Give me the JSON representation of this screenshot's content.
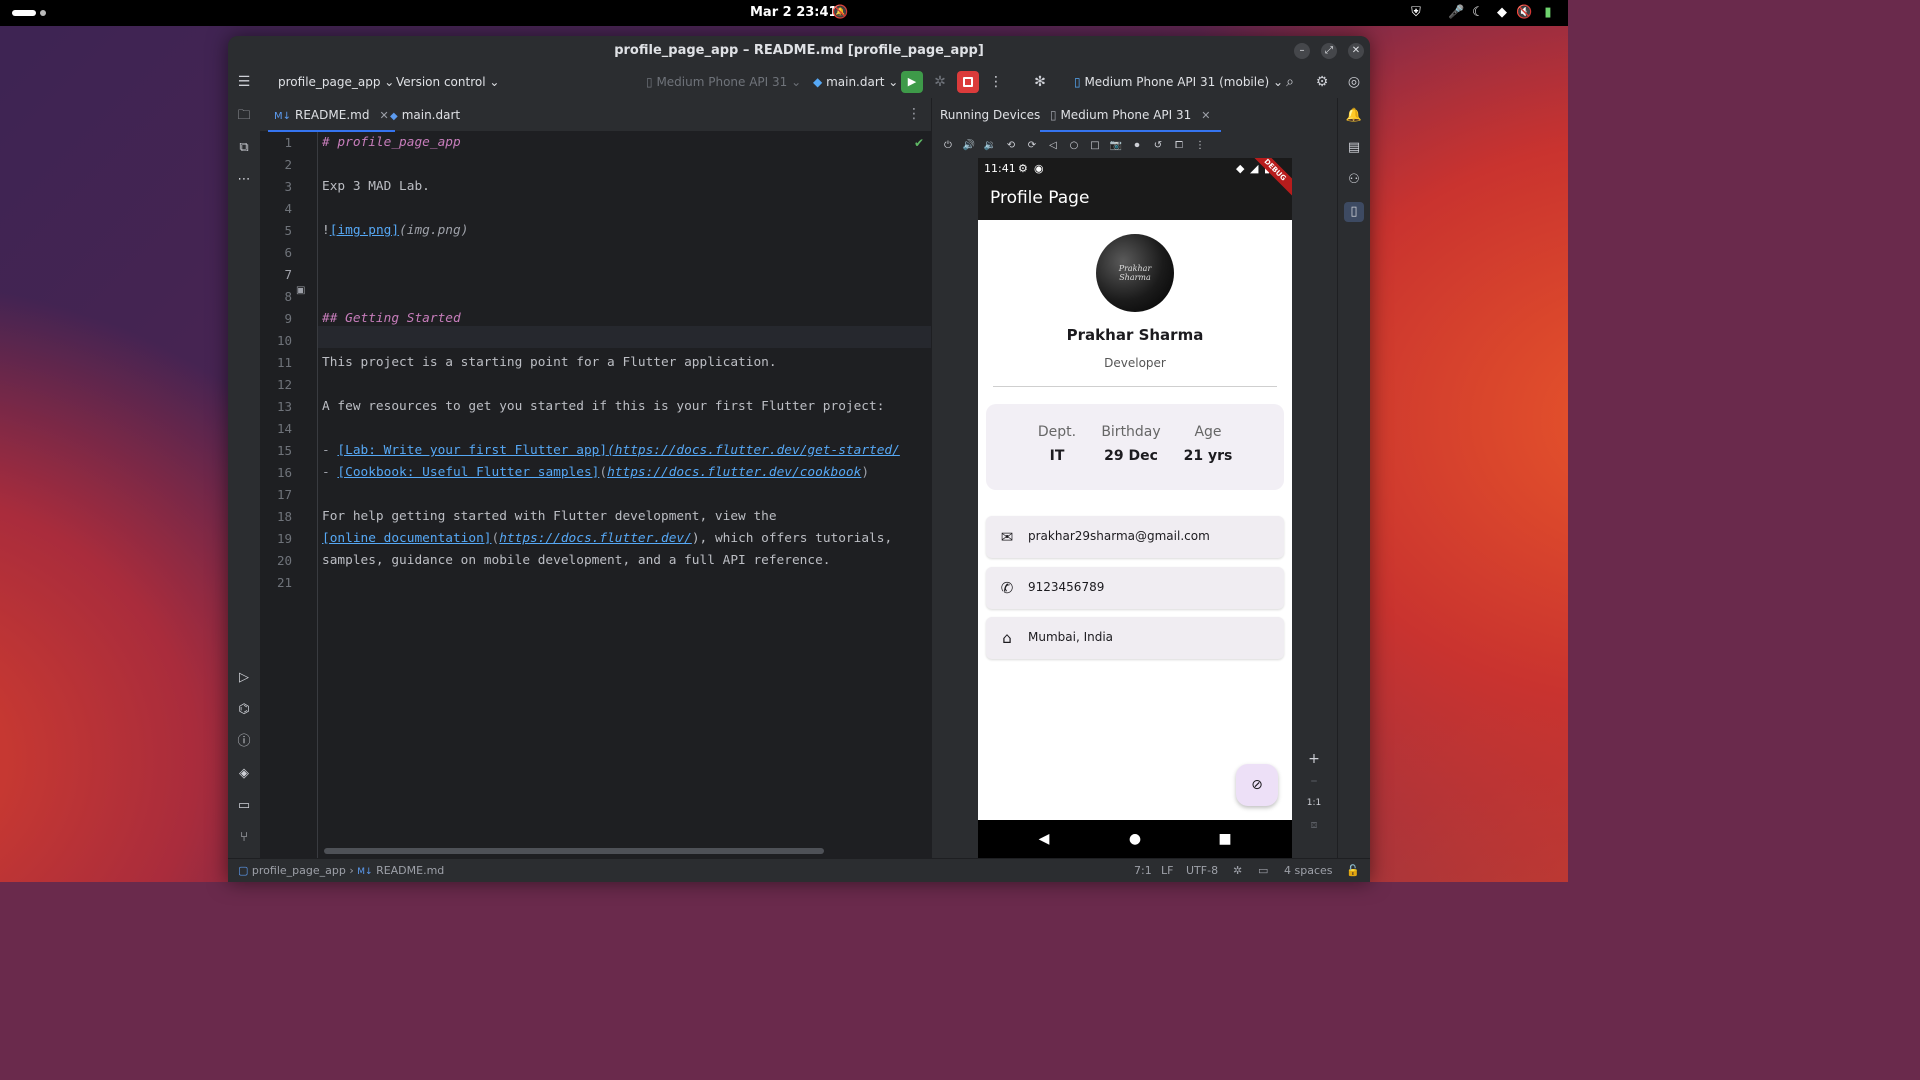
{
  "system": {
    "clock": "Mar 2  23:41"
  },
  "window": {
    "title": "profile_page_app – README.md [profile_page_app]"
  },
  "toolbar": {
    "project": "profile_page_app",
    "vcs": "Version control",
    "device_selector": "Medium Phone API 31",
    "run_config": "main.dart",
    "running_device": "Medium Phone API 31 (mobile)"
  },
  "editor": {
    "tabs": [
      {
        "label": "README.md",
        "icon": "M↓",
        "active": true
      },
      {
        "label": "main.dart",
        "icon": "dart-file-icon",
        "active": false
      }
    ],
    "current_line": 7,
    "lines": [
      {
        "n": "1",
        "text": "# profile_page_app"
      },
      {
        "n": "2",
        "text": ""
      },
      {
        "n": "3",
        "text": "Exp 3 MAD Lab."
      },
      {
        "n": "4",
        "text": ""
      },
      {
        "n": "5",
        "text": "![img.png](img.png)"
      },
      {
        "n": "6",
        "text": ""
      },
      {
        "n": "7",
        "text": ""
      },
      {
        "n": "8",
        "text": ""
      },
      {
        "n": "9",
        "text": "## Getting Started"
      },
      {
        "n": "10",
        "text": ""
      },
      {
        "n": "11",
        "text": "This project is a starting point for a Flutter application."
      },
      {
        "n": "12",
        "text": ""
      },
      {
        "n": "13",
        "text": "A few resources to get you started if this is your first Flutter project:"
      },
      {
        "n": "14",
        "text": ""
      },
      {
        "n": "15",
        "text": "- [Lab: Write your first Flutter app](https://docs.flutter.dev/get-started/"
      },
      {
        "n": "16",
        "text": "- [Cookbook: Useful Flutter samples](https://docs.flutter.dev/cookbook)"
      },
      {
        "n": "17",
        "text": ""
      },
      {
        "n": "18",
        "text": "For help getting started with Flutter development, view the"
      },
      {
        "n": "19",
        "text": "[online documentation](https://docs.flutter.dev/), which offers tutorials,"
      },
      {
        "n": "20",
        "text": "samples, guidance on mobile development, and a full API reference."
      },
      {
        "n": "21",
        "text": ""
      }
    ],
    "segments": {
      "l1": "# profile_page_app",
      "l3": "Exp 3 MAD Lab.",
      "l5_bang": "!",
      "l5_text": "[img.png]",
      "l5_url": "(img.png)",
      "l9": "## Getting Started",
      "l11": "This project is a starting point for a Flutter application.",
      "l13": "A few resources to get you started if this is your first Flutter project:",
      "l15_dash": "- ",
      "l15_text": "[Lab: Write your first Flutter app]",
      "l15_url": "(https://docs.flutter.dev/get-started/",
      "l16_dash": "- ",
      "l16_text": "[Cookbook: Useful Flutter samples]",
      "l16_url_open": "(",
      "l16_url": "https://docs.flutter.dev/cookbook",
      "l16_url_close": ")",
      "l18": "For help getting started with Flutter development, view the",
      "l19_text": "[online documentation]",
      "l19_url_open": "(",
      "l19_url": "https://docs.flutter.dev/",
      "l19_rest": "), which offers tutorials,",
      "l20": "samples, guidance on mobile development, and a full API reference."
    }
  },
  "running_devices": {
    "panel_title": "Running Devices",
    "tab_label": "Medium Phone API 31",
    "zoom_label": "1:1"
  },
  "phone": {
    "status_time": "11:41",
    "debug_banner": "DEBUG",
    "appbar_title": "Profile Page",
    "avatar_signature": "Prakhar Sharma",
    "name": "Prakhar Sharma",
    "role": "Developer",
    "stats": [
      {
        "label": "Dept.",
        "value": "IT"
      },
      {
        "label": "Birthday",
        "value": "29 Dec"
      },
      {
        "label": "Age",
        "value": "21 yrs"
      }
    ],
    "contacts": [
      {
        "icon": "email-icon",
        "text": "prakhar29sharma@gmail.com"
      },
      {
        "icon": "phone-icon",
        "text": "9123456789"
      },
      {
        "icon": "home-icon",
        "text": "Mumbai, India"
      }
    ]
  },
  "statusbar": {
    "breadcrumb_project": "profile_page_app",
    "breadcrumb_file": "README.md",
    "position": "7:1",
    "line_sep": "LF",
    "encoding": "UTF-8",
    "indent": "4 spaces"
  },
  "colors": {
    "accent": "#3574f0",
    "run": "#3e9a49",
    "stop": "#db3b3b",
    "link": "#56a8f5",
    "heading": "#c77dbb"
  }
}
